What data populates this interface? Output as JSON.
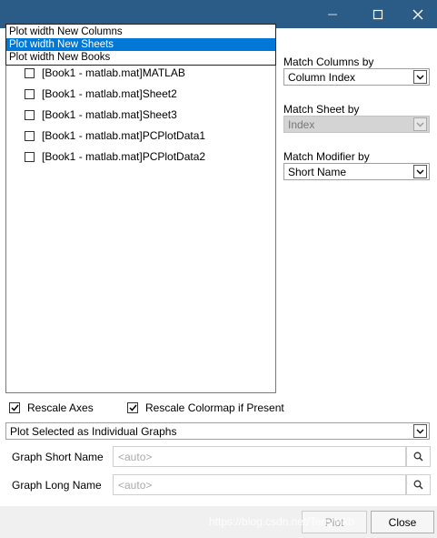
{
  "plot_mode_dropdown": {
    "options": [
      "Plot width New Columns",
      "Plot width New Sheets",
      "Plot width New Books"
    ],
    "selected_index": 1
  },
  "sheets": [
    {
      "label": "[Book1 - matlab.mat]MATLAB",
      "checked": false
    },
    {
      "label": "[Book1 - matlab.mat]Sheet2",
      "checked": false
    },
    {
      "label": "[Book1 - matlab.mat]Sheet3",
      "checked": false
    },
    {
      "label": "[Book1 - matlab.mat]PCPlotData1",
      "checked": false
    },
    {
      "label": "[Book1 - matlab.mat]PCPlotData2",
      "checked": false
    }
  ],
  "match_columns": {
    "label": "Match Columns by",
    "value": "Column Index"
  },
  "match_sheet": {
    "label": "Match Sheet by",
    "value": "Index",
    "disabled": true
  },
  "match_modifier": {
    "label": "Match Modifier by",
    "value": "Short Name"
  },
  "rescale_axes": {
    "label": "Rescale Axes",
    "checked": true
  },
  "rescale_colormap": {
    "label": "Rescale Colormap if Present",
    "checked": true
  },
  "plot_option": {
    "value": "Plot Selected as Individual Graphs"
  },
  "graph_short_name": {
    "label": "Graph Short Name",
    "placeholder": "<auto>",
    "value": ""
  },
  "graph_long_name": {
    "label": "Graph Long Name",
    "placeholder": "<auto>",
    "value": ""
  },
  "buttons": {
    "plot": "Plot",
    "close": "Close"
  },
  "watermark": "https://blog.csdn.net/TerryMkb",
  "colors": {
    "titlebar": "#2b5c87",
    "selection": "#0078d7",
    "footer": "#f0f0f0"
  },
  "icons": {
    "minimize": "minimize-icon",
    "maximize": "maximize-icon",
    "close": "close-icon",
    "dropdown": "chevron-down-icon",
    "search": "search-icon",
    "checkmark": "checkmark-icon"
  }
}
